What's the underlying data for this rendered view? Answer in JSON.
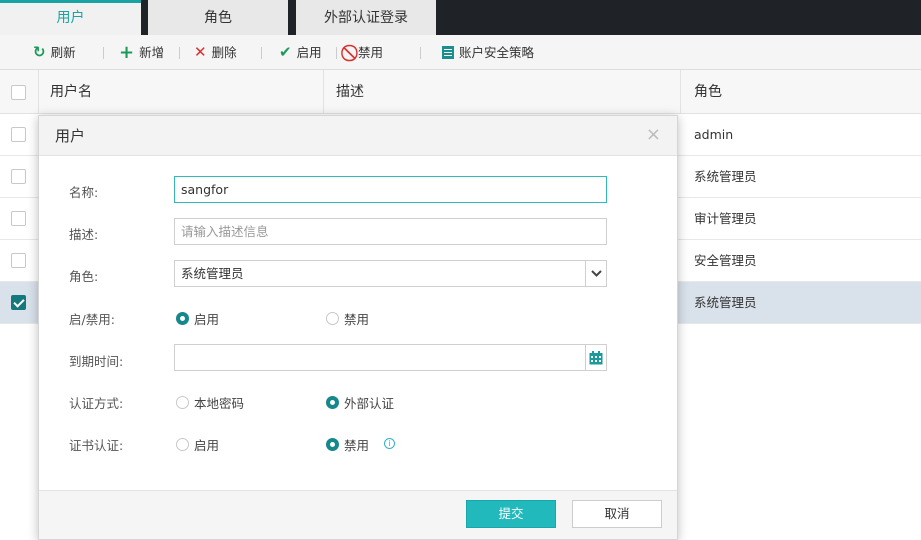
{
  "tabs": [
    {
      "label": "用户",
      "active": true
    },
    {
      "label": "角色",
      "active": false
    },
    {
      "label": "外部认证登录",
      "active": false
    }
  ],
  "toolbar": {
    "refresh": "刷新",
    "add": "新增",
    "delete": "删除",
    "enable": "启用",
    "disable": "禁用",
    "policy": "账户安全策略"
  },
  "table": {
    "headers": {
      "username": "用户名",
      "description": "描述",
      "role": "角色"
    },
    "rows": [
      {
        "role": "admin",
        "checked": false
      },
      {
        "role": "系统管理员",
        "checked": false
      },
      {
        "role": "审计管理员",
        "checked": false
      },
      {
        "role": "安全管理员",
        "checked": false
      },
      {
        "role": "系统管理员",
        "checked": true
      }
    ]
  },
  "modal": {
    "title": "用户",
    "close": "×",
    "fields": {
      "name_label": "名称:",
      "name_value": "sangfor",
      "desc_label": "描述:",
      "desc_placeholder": "请输入描述信息",
      "role_label": "角色:",
      "role_value": "系统管理员",
      "status_label": "启/禁用:",
      "status_enable": "启用",
      "status_disable": "禁用",
      "expire_label": "到期时间:",
      "expire_value": "",
      "auth_label": "认证方式:",
      "auth_local": "本地密码",
      "auth_external": "外部认证",
      "cert_label": "证书认证:",
      "cert_enable": "启用",
      "cert_disable": "禁用"
    },
    "submit": "提交",
    "cancel": "取消"
  },
  "colors": {
    "accent": "#1aa3a3",
    "primary_button": "#22b9bc",
    "tabbar_bg": "#1f2328",
    "selected_row": "#d9e1ea"
  }
}
